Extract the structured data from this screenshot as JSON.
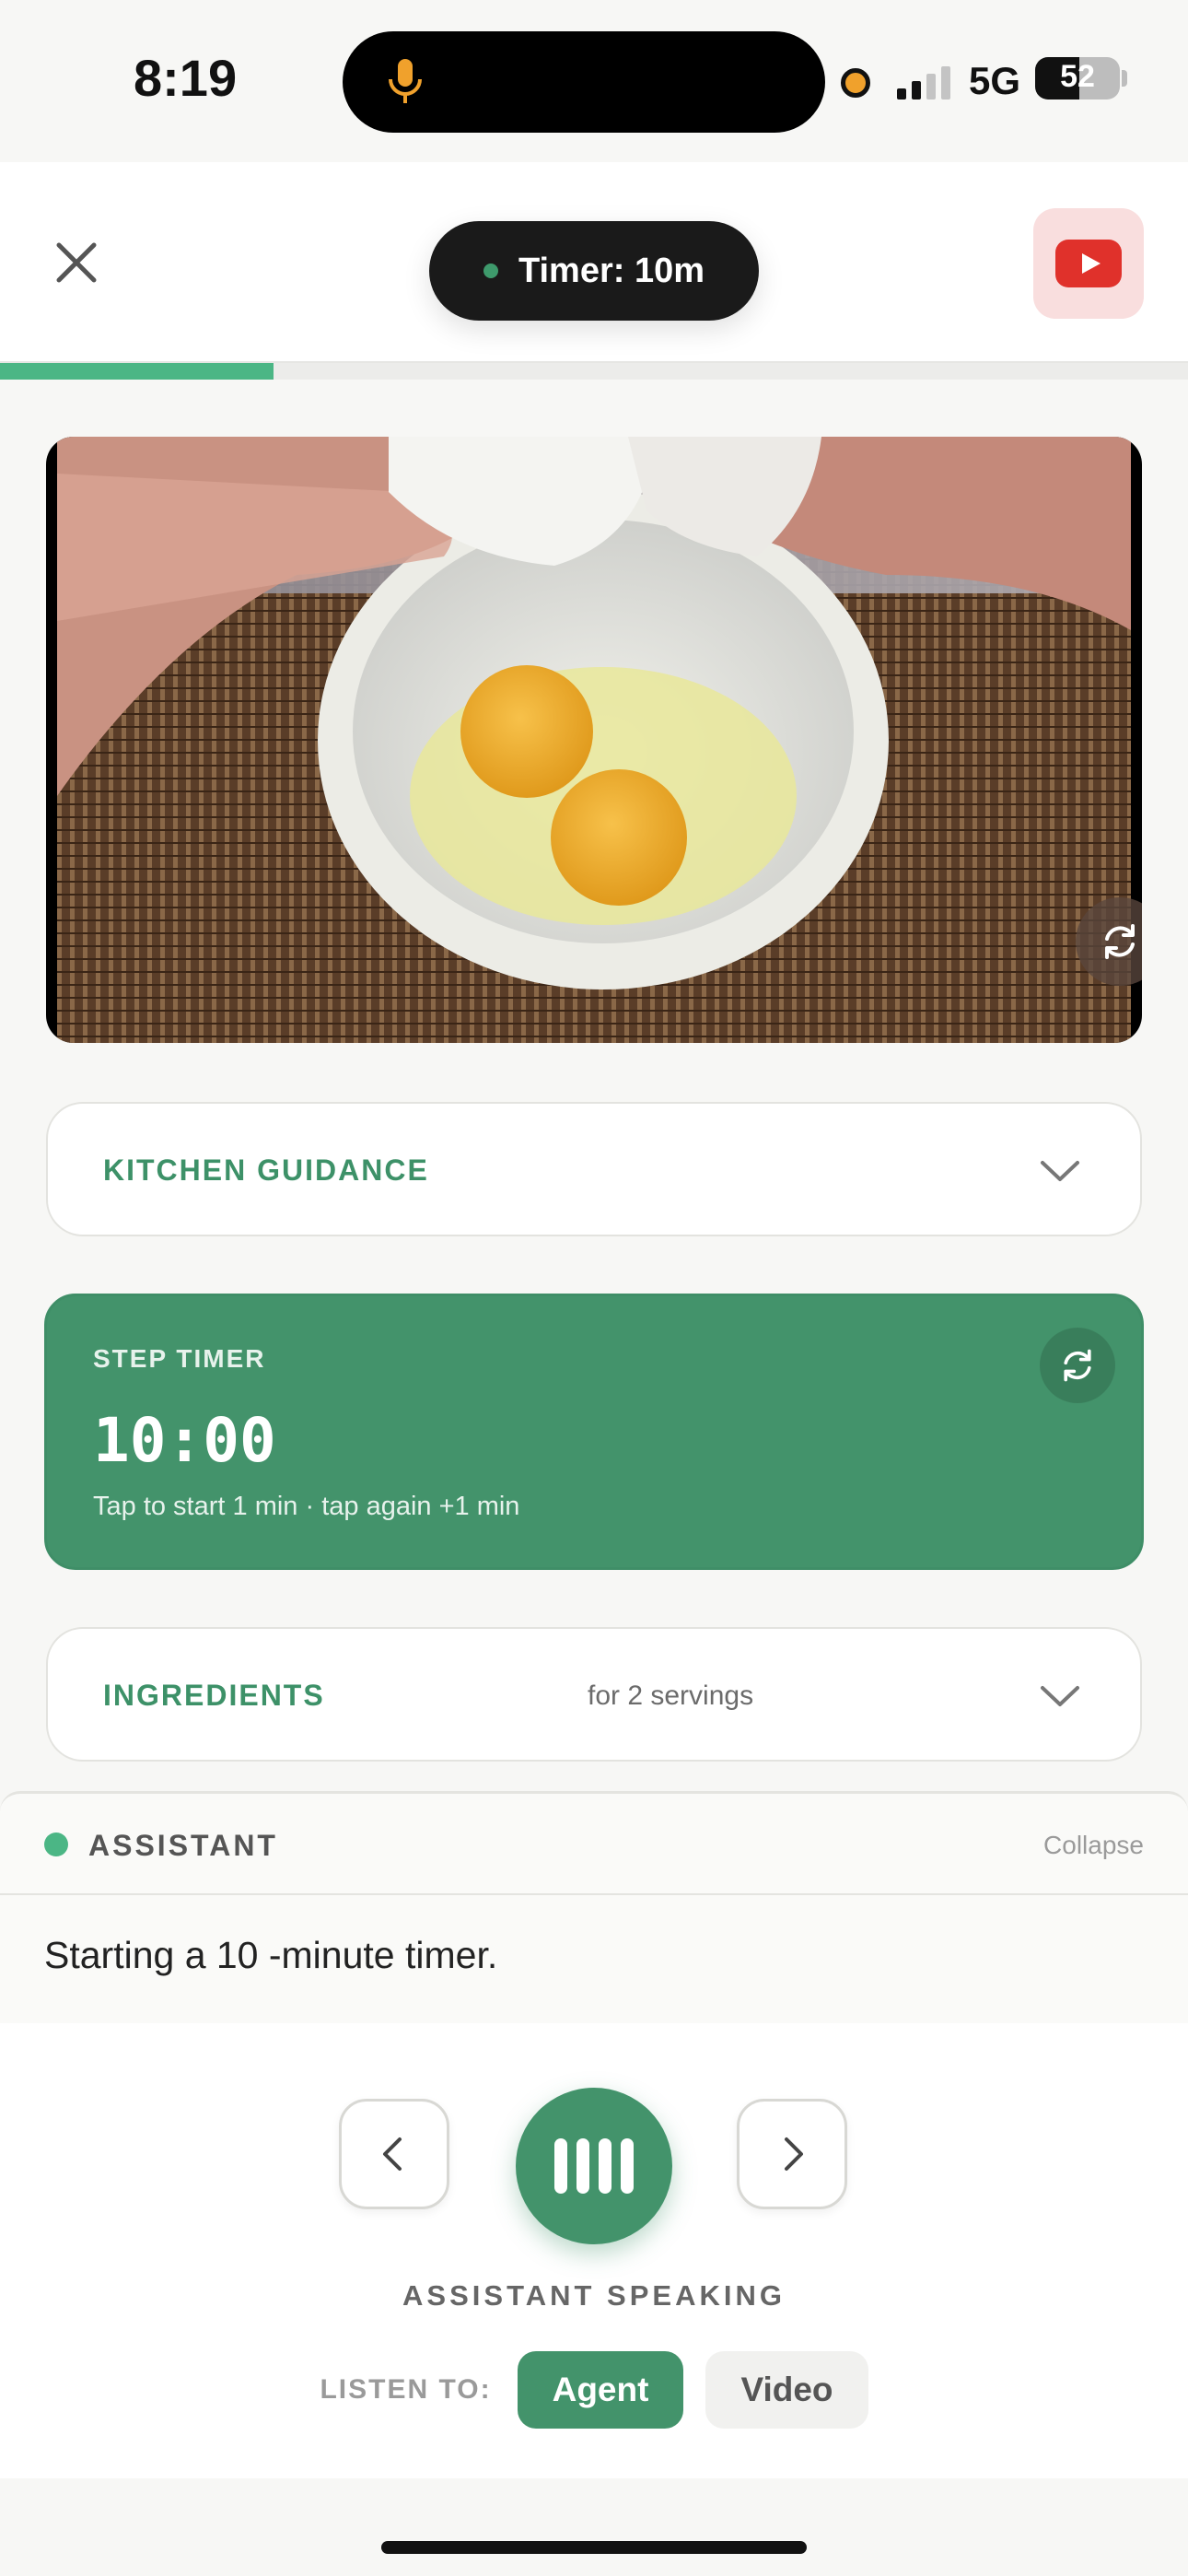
{
  "status_bar": {
    "time": "8:19",
    "network": "5G",
    "battery_percent": 52,
    "battery_label": "52",
    "recording_color": "#f0a12c"
  },
  "header": {
    "timer_pill_label": "Timer: 10m",
    "close_icon": "close-icon",
    "youtube_icon": "youtube-icon",
    "step_progress": 0.23,
    "accent_color": "#43936b"
  },
  "video": {
    "content": "hands cracking two eggs into a white bowl on a bamboo placemat",
    "sync_icon": "sync-icon"
  },
  "kitchen_guidance": {
    "title": "KITCHEN GUIDANCE",
    "expanded": false
  },
  "step_timer": {
    "label": "STEP TIMER",
    "value": "10:00",
    "hint": "Tap to start 1 min · tap again +1 min"
  },
  "ingredients": {
    "title": "INGREDIENTS",
    "servings": "for 2 servings",
    "expanded": false
  },
  "assistant": {
    "title": "ASSISTANT",
    "collapse_label": "Collapse",
    "message": "Starting a 10 -minute timer."
  },
  "controls": {
    "state_label": "ASSISTANT SPEAKING",
    "listen_label": "LISTEN TO:",
    "listen_options": [
      "Agent",
      "Video"
    ],
    "listen_selected": "Agent"
  }
}
